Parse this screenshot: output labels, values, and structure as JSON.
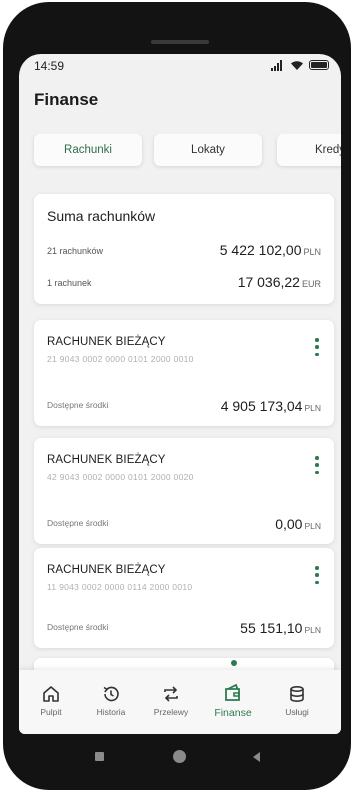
{
  "status": {
    "time": "14:59"
  },
  "header": {
    "title": "Finanse"
  },
  "tabs": [
    {
      "label": "Rachunki",
      "active": true
    },
    {
      "label": "Lokaty",
      "active": false
    },
    {
      "label": "Kredy",
      "active": false
    }
  ],
  "summary": {
    "title": "Suma rachunków",
    "rows": [
      {
        "label": "21 rachunków",
        "amount": "5 422 102,00",
        "currency": "PLN"
      },
      {
        "label": "1 rachunek",
        "amount": "17 036,22",
        "currency": "EUR"
      }
    ]
  },
  "accounts": [
    {
      "name": "RACHUNEK BIEŻĄCY",
      "number": "21 9043 0002 0000 0101 2000 0010",
      "balance_label": "Dostępne środki",
      "balance": "4 905 173,04",
      "currency": "PLN"
    },
    {
      "name": "RACHUNEK BIEŻĄCY",
      "number": "42 9043 0002 0000 0101 2000 0020",
      "balance_label": "Dostępne środki",
      "balance": "0,00",
      "currency": "PLN"
    },
    {
      "name": "RACHUNEK BIEŻĄCY",
      "number": "11 9043 0002 0000 0114 2000 0010",
      "balance_label": "Dostępne środki",
      "balance": "55 151,10",
      "currency": "PLN"
    }
  ],
  "bottom_nav": [
    {
      "label": "Pulpit",
      "icon": "home-icon"
    },
    {
      "label": "Historia",
      "icon": "history-icon"
    },
    {
      "label": "Przelewy",
      "icon": "transfer-icon"
    },
    {
      "label": "Finanse",
      "icon": "finance-icon",
      "active": true
    },
    {
      "label": "Usługi",
      "icon": "services-icon"
    }
  ],
  "colors": {
    "accent": "#2e7a50",
    "background": "#f1f1f1",
    "card": "#ffffff"
  }
}
